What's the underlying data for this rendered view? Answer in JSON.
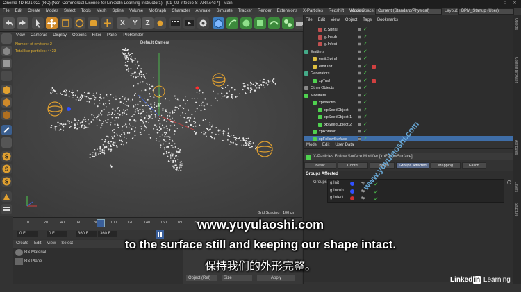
{
  "window": {
    "title": "Cinema 4D R21.022 (RC) (Non-Commercial License for LinkedIn Learning Instructor1) - [01_09-Infectio-START.c4d *] - Main"
  },
  "menubar": {
    "items": [
      "File",
      "Edit",
      "Create",
      "Modes",
      "Select",
      "Tools",
      "Mesh",
      "Spline",
      "Volume",
      "MoGraph",
      "Character",
      "Animate",
      "Simulate",
      "Tracker",
      "Render",
      "Extensions",
      "X-Particles",
      "Redshift",
      "Window"
    ],
    "node_space_label": "Node Space:",
    "node_space_value": "Current (Standard/Physical)",
    "layout_label": "Layout:",
    "layout_value": "BPM_Startup (User)"
  },
  "viewport": {
    "menu": [
      "View",
      "Cameras",
      "Display",
      "Options",
      "Filter",
      "Panel",
      "ProRender"
    ],
    "camera": "Default Camera",
    "hud_emitters": "Number of emitters: 2",
    "hud_particles": "Total live particles: 4423",
    "grid_spacing": "Grid Spacing : 100 cm"
  },
  "timeline": {
    "ticks": [
      "0",
      "20",
      "40",
      "60",
      "80",
      "100",
      "120",
      "140",
      "160",
      "180",
      "200",
      "220"
    ],
    "current_frame": "0 F",
    "start_frame": "0 F",
    "end_frame": "360 F",
    "end_frame_2": "360 F"
  },
  "materials": {
    "menu": [
      "Create",
      "Edit",
      "View",
      "Select"
    ],
    "items": [
      "RS Material",
      "RS Plane"
    ]
  },
  "coords": {
    "mode": "Object (Rel)",
    "size": "Size",
    "apply": "Apply"
  },
  "object_manager": {
    "menu": [
      "File",
      "Edit",
      "View",
      "Object",
      "Tags",
      "Bookmarks"
    ],
    "rows": [
      {
        "name": "g.Spiral"
      },
      {
        "name": "g.Incub"
      },
      {
        "name": "g.Infect"
      },
      {
        "name": "Emitters"
      },
      {
        "name": "emit.Spiral"
      },
      {
        "name": "emit.Init"
      },
      {
        "name": "Generators"
      },
      {
        "name": "xpTrail"
      },
      {
        "name": "Other Objects"
      },
      {
        "name": "Modifiers"
      },
      {
        "name": "xpInfectio"
      },
      {
        "name": "xpSeedObject"
      },
      {
        "name": "xpSeedObject.1"
      },
      {
        "name": "xpSeedObject.2"
      },
      {
        "name": "xpRotator"
      },
      {
        "name": "xpFollowSurface"
      }
    ]
  },
  "attribute_manager": {
    "menu": [
      "Mode",
      "Edit",
      "User Data"
    ],
    "header": "X-Particles Follow Surface Modifier [xpFollowSurface]",
    "tabs": [
      "Basic",
      "Coord.",
      "Object",
      "Groups Affected",
      "Mapping",
      "Falloff"
    ],
    "active_tab": "Groups Affected",
    "section": "Groups Affected",
    "groups_label": "Groups",
    "groups": [
      "g.Init",
      "g.Incub",
      "g.Infect"
    ]
  },
  "side_tabs": [
    "Objects",
    "Content Browser",
    "Attributes",
    "Layers",
    "Structure"
  ],
  "subtitles": {
    "site": "www.yuyulaoshi.com",
    "english": "to the surface still and keeping our shape intact.",
    "chinese": "保持我们的外形完整。"
  },
  "watermark": "www.yuyulaoshi.com",
  "branding": {
    "linkedin_a": "Linked",
    "linkedin_b": "in",
    "linkedin_c": "Learning"
  },
  "colors": {
    "accent": "#5b6b8b",
    "check": "#4fd14f",
    "hud": "#e0b030",
    "selection": "#3f6ea8"
  }
}
